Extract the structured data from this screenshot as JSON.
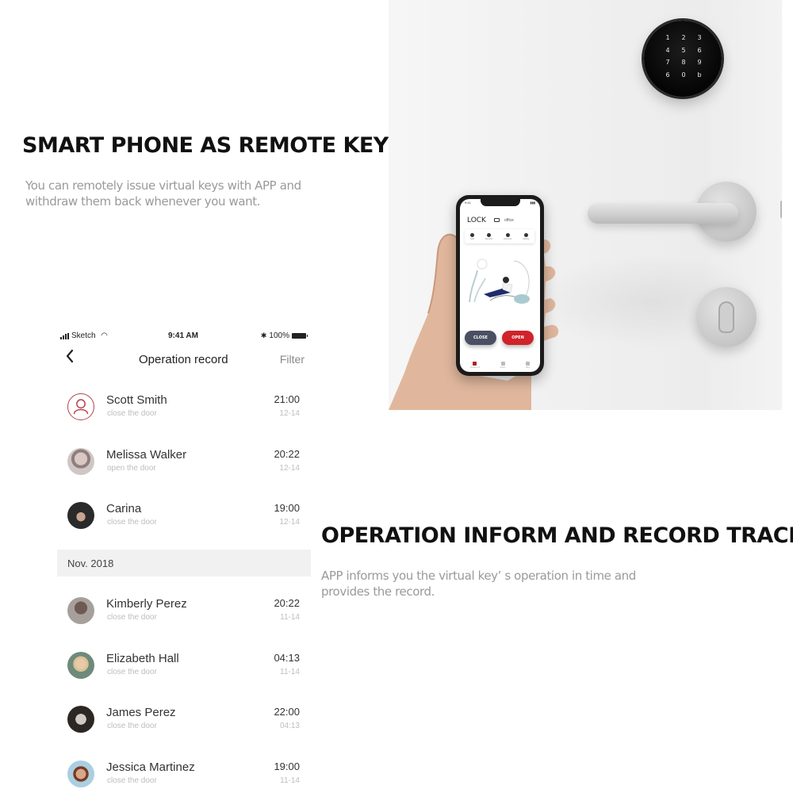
{
  "section1": {
    "headline": "SMART PHONE AS REMOTE KEY",
    "description": "You can remotely issue virtual keys with APP and withdraw them back whenever you want."
  },
  "section2": {
    "headline": "OPERATION INFORM AND RECORD TRACE",
    "description": "APP informs you the virtual key’  s operation in time and provides the record."
  },
  "photo": {
    "keypad_keys": [
      "1",
      "2",
      "3",
      "4",
      "5",
      "6",
      "7",
      "8",
      "9",
      "6",
      "0",
      "b"
    ],
    "phone": {
      "app_title": "LOCK",
      "device_name": "office",
      "tabs": [
        "Add",
        "Records",
        "Accounts",
        "Setting"
      ],
      "close_label": "CLOSE",
      "open_label": "OPEN",
      "nav": [
        "Workbench",
        "Notice",
        "Mine"
      ],
      "colors": {
        "close": "#4a4f62",
        "open": "#d0232b"
      }
    }
  },
  "app": {
    "statusbar": {
      "carrier": "Sketch",
      "time": "9:41 AM",
      "battery": "100%"
    },
    "navbar": {
      "back_icon": "chevron-left-icon",
      "title": "Operation record",
      "filter_label": "Filter"
    },
    "records_recent": [
      {
        "name": "Scott Smith",
        "action": "close the door",
        "time": "21:00",
        "date": "12-14",
        "avatar": "default-user-icon"
      },
      {
        "name": "Melissa Walker",
        "action": "open the door",
        "time": "20:22",
        "date": "12-14",
        "avatar": "photo"
      },
      {
        "name": "Carina",
        "action": "close the door",
        "time": "19:00",
        "date": "12-14",
        "avatar": "photo"
      }
    ],
    "section_header": "Nov. 2018",
    "records_nov": [
      {
        "name": "Kimberly Perez",
        "action": "close the door",
        "time": "20:22",
        "date": "11-14",
        "avatar": "photo"
      },
      {
        "name": "Elizabeth Hall",
        "action": "close the door",
        "time": "04:13",
        "date": "11-14",
        "avatar": "photo"
      },
      {
        "name": "James Perez",
        "action": "close the door",
        "time": "22:00",
        "date": "04:13",
        "avatar": "photo"
      },
      {
        "name": "Jessica Martinez",
        "action": "close the door",
        "time": "19:00",
        "date": "11-14",
        "avatar": "photo"
      }
    ],
    "accent_color": "#b8444b"
  }
}
